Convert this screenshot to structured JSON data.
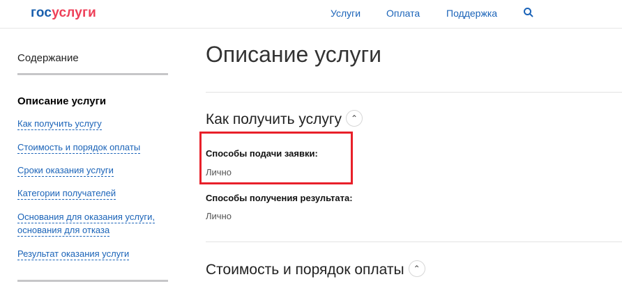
{
  "header": {
    "logo_part1": "гос",
    "logo_part2": "услуги",
    "nav": [
      "Услуги",
      "Оплата",
      "Поддержка"
    ]
  },
  "sidebar": {
    "title": "Содержание",
    "current": "Описание услуги",
    "links": [
      "Как получить услугу",
      "Стоимость и порядок оплаты",
      "Сроки оказания услуги",
      "Категории получателей",
      "Основания для оказания услуги,",
      "основания для отказа",
      "Результат оказания услуги"
    ]
  },
  "main": {
    "title": "Описание услуги",
    "section1": {
      "heading": "Как получить услугу",
      "fields": [
        {
          "label": "Способы подачи заявки:",
          "value": "Лично"
        },
        {
          "label": "Способы получения результата:",
          "value": "Лично"
        }
      ]
    },
    "section2": {
      "heading": "Стоимость и порядок оплаты"
    }
  }
}
